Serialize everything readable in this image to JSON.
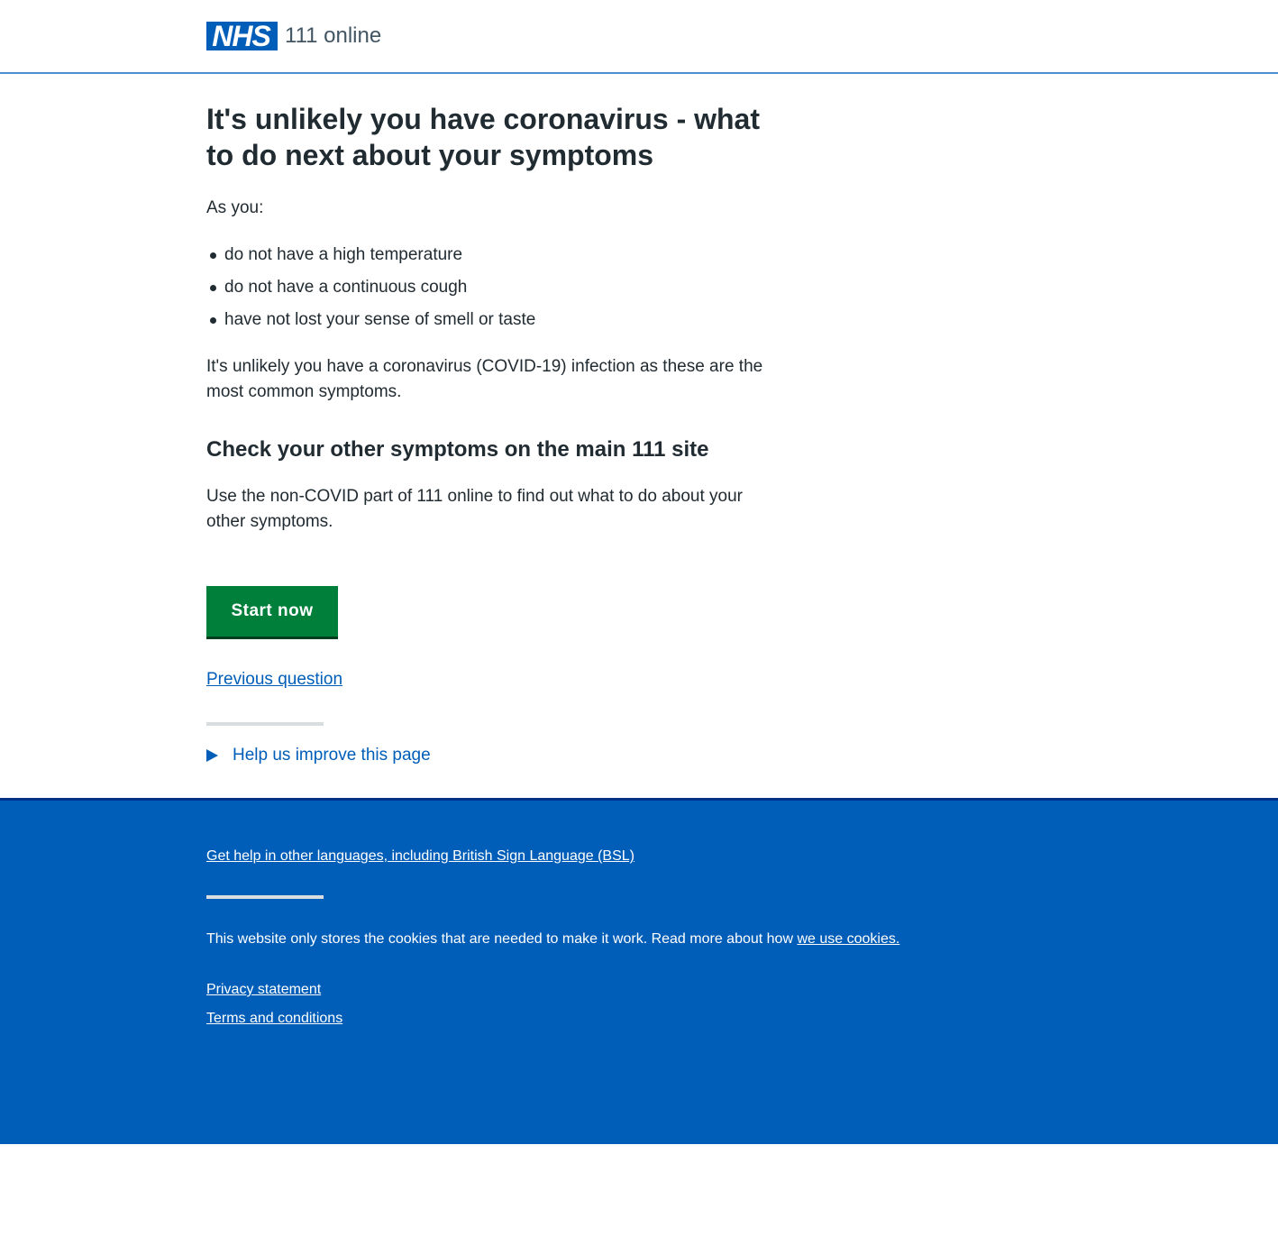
{
  "header": {
    "logo_text": "NHS",
    "service_name": "111 online"
  },
  "main": {
    "title": "It's unlikely you have coronavirus - what to do next about your symptoms",
    "intro": "As you:",
    "bullets": [
      "do not have a high temperature",
      "do not have a continuous cough",
      "have not lost your sense of smell or taste"
    ],
    "unlikely_text": "It's unlikely you have a coronavirus (COVID-19) infection as these are the most common symptoms.",
    "subheading": "Check your other symptoms on the main 111 site",
    "use_text": "Use the non-COVID part of 111 online to find out what to do about your other symptoms.",
    "start_button": "Start now",
    "previous_link": "Previous question",
    "help_improve": "Help us improve this page"
  },
  "footer": {
    "languages_link": "Get help in other languages, including British Sign Language (BSL)",
    "cookies_text": "This website only stores the cookies that are needed to make it work. Read more about how ",
    "cookies_link": "we use cookies.",
    "privacy_link": "Privacy statement",
    "terms_link": "Terms and conditions"
  },
  "colors": {
    "nhs_blue": "#005eb8",
    "button_green": "#007f3b",
    "text": "#212b32",
    "footer_border": "#003087"
  }
}
